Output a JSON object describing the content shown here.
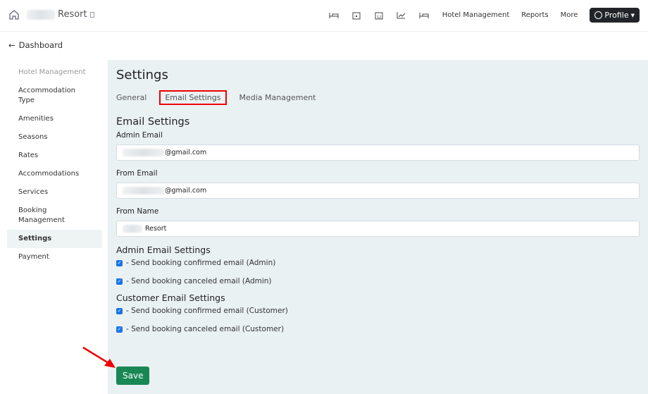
{
  "header": {
    "brand_suffix": "Resort",
    "nav_links": [
      "Hotel Management",
      "Reports",
      "More"
    ],
    "profile_label": "Profile"
  },
  "back_label": "Dashboard",
  "sidebar": {
    "section": "Hotel Management",
    "items": [
      "Accommodation Type",
      "Amenities",
      "Seasons",
      "Rates",
      "Accommodations",
      "Services",
      "Booking Management",
      "Settings",
      "Payment"
    ],
    "active": "Settings"
  },
  "main": {
    "title": "Settings",
    "tabs": [
      "General",
      "Email Settings",
      "Media Management"
    ],
    "active_tab": "Email Settings",
    "section_title": "Email Settings",
    "admin_email": {
      "label": "Admin Email",
      "value_suffix": "@gmail.com"
    },
    "from_email": {
      "label": "From Email",
      "value_suffix": "@gmail.com"
    },
    "from_name": {
      "label": "From Name",
      "value_suffix": "Resort"
    },
    "admin_settings": {
      "title": "Admin Email Settings",
      "options": [
        {
          "label": "- Send booking confirmed email (Admin)",
          "checked": true
        },
        {
          "label": "- Send booking canceled email (Admin)",
          "checked": true
        }
      ]
    },
    "customer_settings": {
      "title": "Customer Email Settings",
      "options": [
        {
          "label": "- Send booking confirmed email (Customer)",
          "checked": true
        },
        {
          "label": "- Send booking canceled email (Customer)",
          "checked": true
        }
      ]
    },
    "save_label": "Save"
  }
}
